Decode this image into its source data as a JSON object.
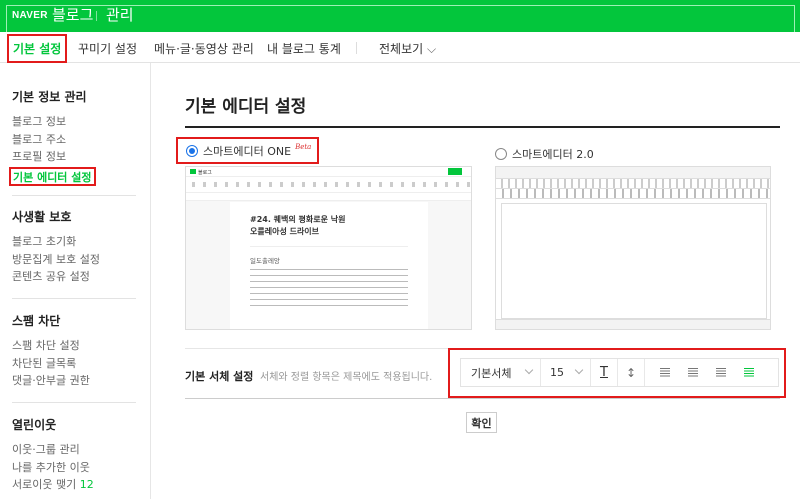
{
  "header": {
    "logo": "NAVER",
    "service": "블로그",
    "section": "관리"
  },
  "nav": {
    "tabs": [
      "기본 설정",
      "꾸미기 설정",
      "메뉴·글·동영상 관리",
      "내 블로그 통계"
    ],
    "all_view": "전체보기"
  },
  "sidebar": {
    "groups": [
      {
        "title": "기본 정보 관리",
        "items": [
          "블로그 정보",
          "블로그 주소",
          "프로필 정보",
          "기본 에디터 설정"
        ]
      },
      {
        "title": "사생활 보호",
        "items": [
          "블로그 초기화",
          "방문집계 보호 설정",
          "콘텐츠 공유 설정"
        ]
      },
      {
        "title": "스팸 차단",
        "items": [
          "스팸 차단 설정",
          "차단된 글목록",
          "댓글·안부글 권한"
        ]
      },
      {
        "title": "열린이웃",
        "items": [
          "이웃·그룹 관리",
          "나를 추가한 이웃",
          "서로이웃 맺기"
        ],
        "count": "12"
      }
    ]
  },
  "main": {
    "title": "기본 에디터 설정",
    "editors": [
      {
        "label": "스마트에디터 ONE",
        "badge": "Beta",
        "selected": true
      },
      {
        "label": "스마트에디터 2.0",
        "selected": false
      }
    ],
    "preview": {
      "app": "블로그",
      "post_title_1": "#24. 퀘백의 평화로운 낙원",
      "post_title_2": "오를레아성 드라이브",
      "subheading": "일도출레앙"
    },
    "font": {
      "label": "기본 서체 설정",
      "desc": "서체와 정렬 항목은 제목에도 적용됩니다.",
      "font_value": "기본서체",
      "size_value": "15",
      "active_align": "justify"
    },
    "confirm": "확인"
  },
  "colors": {
    "brand": "#03c63c",
    "highlight": "#e21b1b"
  }
}
